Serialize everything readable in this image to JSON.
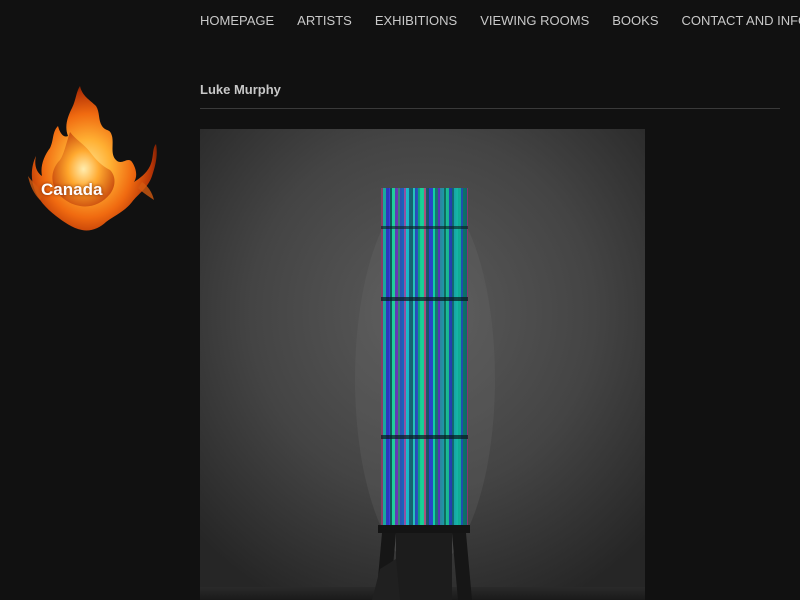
{
  "nav": {
    "items": [
      {
        "label": "HOMEPAGE"
      },
      {
        "label": "ARTISTS"
      },
      {
        "label": "EXHIBITIONS"
      },
      {
        "label": "VIEWING ROOMS"
      },
      {
        "label": "BOOKS"
      },
      {
        "label": "CONTACT AND INFO"
      }
    ]
  },
  "logo": {
    "text": "Canada",
    "icon": "flame-icon"
  },
  "artist": {
    "name": "Luke Murphy"
  },
  "artwork": {
    "icon": "artwork-photo"
  },
  "colors": {
    "background": "#111111",
    "nav_text": "#c9c9c9",
    "heading_text": "#c8c8c8",
    "flame_orange": "#f07a1a"
  }
}
